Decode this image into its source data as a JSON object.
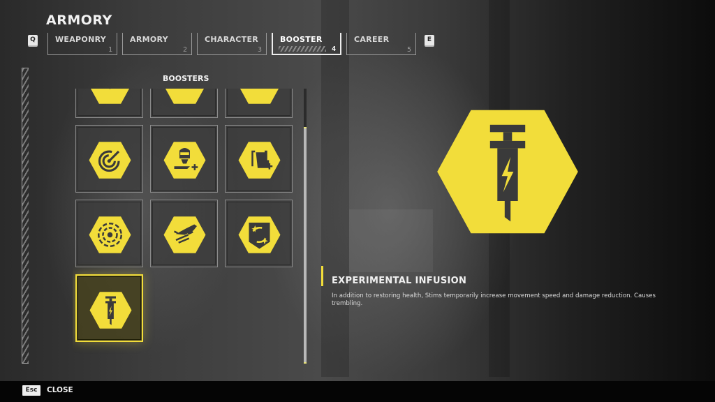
{
  "header": {
    "title": "ARMORY",
    "prev_key": "Q",
    "next_key": "E"
  },
  "tabs": [
    {
      "label": "WEAPONRY",
      "number": "1",
      "active": false
    },
    {
      "label": "ARMORY",
      "number": "2",
      "active": false
    },
    {
      "label": "CHARACTER",
      "number": "3",
      "active": false
    },
    {
      "label": "BOOSTER",
      "number": "4",
      "active": true
    },
    {
      "label": "CAREER",
      "number": "5",
      "active": false
    }
  ],
  "section": {
    "title": "BOOSTERS"
  },
  "boosters": [
    {
      "icon": "chevron-down-icon",
      "selected": false
    },
    {
      "icon": "arrow-turn-icon",
      "selected": false
    },
    {
      "icon": "double-chevron-icon",
      "selected": false
    },
    {
      "icon": "radar-icon",
      "selected": false
    },
    {
      "icon": "helmet-hand-plus-icon",
      "selected": false
    },
    {
      "icon": "supply-plus-icon",
      "selected": false
    },
    {
      "icon": "dashed-target-icon",
      "selected": false
    },
    {
      "icon": "stratagem-jet-icon",
      "selected": false
    },
    {
      "icon": "shield-swap-icon",
      "selected": false
    },
    {
      "icon": "syringe-bolt-icon",
      "selected": true
    }
  ],
  "scroll": {
    "thumb_start_fraction": 0.14,
    "thumb_size_fraction": 0.86
  },
  "detail": {
    "icon": "syringe-bolt-icon",
    "name": "EXPERIMENTAL INFUSION",
    "description": "In addition to restoring health, Stims temporarily increase movement speed and damage reduction. Causes trembling."
  },
  "footer": {
    "close_key": "Esc",
    "close_label": "CLOSE"
  },
  "colors": {
    "accent_yellow": "#f2dd3a",
    "icon_dark": "#3a3a3a"
  }
}
